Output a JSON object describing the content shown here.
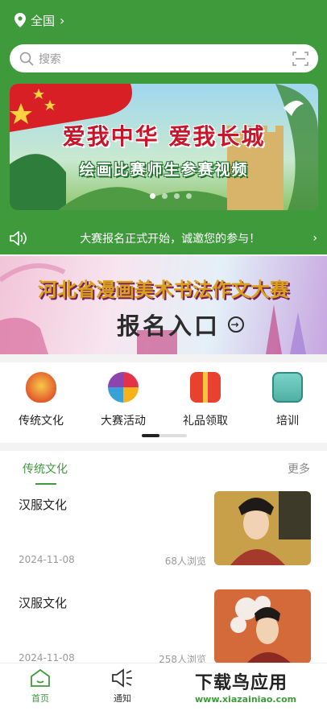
{
  "header": {
    "location": "全国",
    "search_placeholder": "搜索",
    "notice": "大赛报名正式开始，诚邀您的参与！"
  },
  "banner_main": {
    "title": "爱我中华  爱我长城",
    "subtitle": "绘画比赛师生参赛视频",
    "slides": 4,
    "active_slide": 1
  },
  "banner_signup": {
    "title": "河北省漫画美术书法作文大赛",
    "cta": "报名入口"
  },
  "categories": [
    {
      "label": "传统文化",
      "icon": "mask-icon"
    },
    {
      "label": "大赛活动",
      "icon": "pinwheel-icon"
    },
    {
      "label": "礼品领取",
      "icon": "gift-icon"
    },
    {
      "label": "培训",
      "icon": "certificate-icon"
    }
  ],
  "news": {
    "tab": "传统文化",
    "more": "更多",
    "items": [
      {
        "title": "汉服文化",
        "date": "2024-11-08",
        "views": "68人浏览"
      },
      {
        "title": "汉服文化",
        "date": "2024-11-08",
        "views": "258人浏览"
      }
    ]
  },
  "tabbar": {
    "home": "首页",
    "notify": "通知"
  },
  "watermark": {
    "line1": "下载鸟应用",
    "line2": "www.xiazainiao.com"
  },
  "colors": {
    "brand_green": "#3f9a3c",
    "background": "#f3f3f3"
  }
}
